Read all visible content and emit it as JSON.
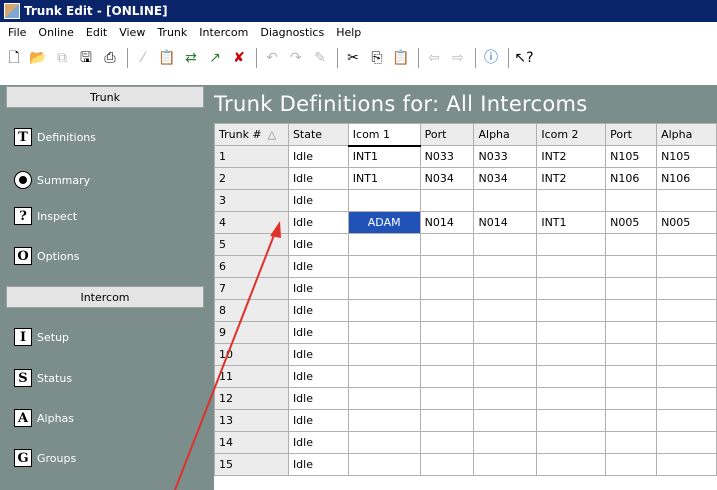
{
  "window": {
    "title": "Trunk Edit - [ONLINE]"
  },
  "menu": [
    "File",
    "Online",
    "Edit",
    "View",
    "Trunk",
    "Intercom",
    "Diagnostics",
    "Help"
  ],
  "toolbar": {
    "icons": [
      "new-document-icon",
      "open-folder-icon",
      "copy-icon",
      "save-icon",
      "print-icon",
      "wand-icon",
      "clipboard-icon",
      "connect-icon",
      "signal-icon",
      "disconnect-icon",
      "undo-icon",
      "redo-icon",
      "pen-icon",
      "cut-icon",
      "copy2-icon",
      "paste-icon",
      "back-arrow-icon",
      "forward-arrow-icon",
      "info-icon",
      "help-pointer-icon"
    ]
  },
  "sidebar": {
    "trunk_header": "Trunk",
    "trunk_items": [
      {
        "icon": "T",
        "label": "Definitions"
      },
      {
        "icon": "radio",
        "label": "Summary"
      },
      {
        "icon": "?",
        "label": "Inspect"
      },
      {
        "icon": "O",
        "label": "Options"
      }
    ],
    "intercom_header": "Intercom",
    "intercom_items": [
      {
        "icon": "I",
        "label": "Setup"
      },
      {
        "icon": "S",
        "label": "Status"
      },
      {
        "icon": "A",
        "label": "Alphas"
      },
      {
        "icon": "G",
        "label": "Groups"
      }
    ]
  },
  "main": {
    "title": "Trunk Definitions for:  All Intercoms",
    "columns": [
      "Trunk #",
      "State",
      "Icom 1",
      "Port",
      "Alpha",
      "Icom 2",
      "Port",
      "Alpha"
    ],
    "sort_indicator": "△",
    "rows": [
      [
        "1",
        "Idle",
        "INT1",
        "N033",
        "N033",
        "INT2",
        "N105",
        "N105"
      ],
      [
        "2",
        "Idle",
        "INT1",
        "N034",
        "N034",
        "INT2",
        "N106",
        "N106"
      ],
      [
        "3",
        "Idle",
        "",
        "",
        "",
        "",
        "",
        ""
      ],
      [
        "4",
        "Idle",
        "ADAM",
        "N014",
        "N014",
        "INT1",
        "N005",
        "N005"
      ],
      [
        "5",
        "Idle",
        "",
        "",
        "",
        "",
        "",
        ""
      ],
      [
        "6",
        "Idle",
        "",
        "",
        "",
        "",
        "",
        ""
      ],
      [
        "7",
        "Idle",
        "",
        "",
        "",
        "",
        "",
        ""
      ],
      [
        "8",
        "Idle",
        "",
        "",
        "",
        "",
        "",
        ""
      ],
      [
        "9",
        "Idle",
        "",
        "",
        "",
        "",
        "",
        ""
      ],
      [
        "10",
        "Idle",
        "",
        "",
        "",
        "",
        "",
        ""
      ],
      [
        "11",
        "Idle",
        "",
        "",
        "",
        "",
        "",
        ""
      ],
      [
        "12",
        "Idle",
        "",
        "",
        "",
        "",
        "",
        ""
      ],
      [
        "13",
        "Idle",
        "",
        "",
        "",
        "",
        "",
        ""
      ],
      [
        "14",
        "Idle",
        "",
        "",
        "",
        "",
        "",
        ""
      ],
      [
        "15",
        "Idle",
        "",
        "",
        "",
        "",
        "",
        ""
      ]
    ],
    "selected_cell": {
      "row": 4,
      "column": "Icom 1"
    }
  },
  "colors": {
    "title_bar": "#0a246a",
    "panel": "#7c8e8b",
    "selection": "#2052b8",
    "annotation_arrow": "#e0302a"
  }
}
